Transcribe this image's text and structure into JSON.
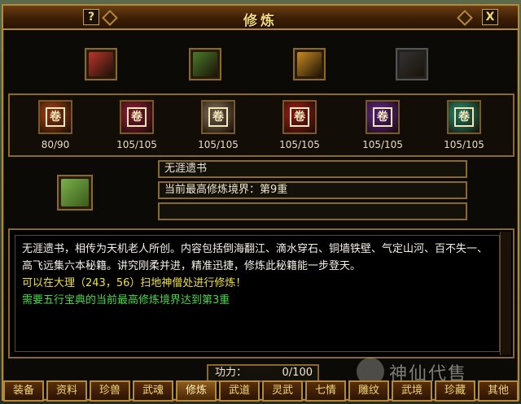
{
  "window": {
    "title": "修炼",
    "help_label": "?",
    "close_label": "X"
  },
  "top_items": [
    {
      "icon": "red-book-icon",
      "color": "#b8352a"
    },
    {
      "icon": "bamboo-scroll-icon",
      "color": "#4a7a2a"
    },
    {
      "icon": "golden-treasure-icon",
      "color": "#c88a20"
    },
    {
      "icon": "empty-slot-icon",
      "color": "#333333"
    }
  ],
  "skills": [
    {
      "value": "80/90",
      "color": "#b34a1a",
      "glyph": "卷"
    },
    {
      "value": "105/105",
      "color": "#a02040",
      "glyph": "卷"
    },
    {
      "value": "105/105",
      "color": "#8a7a60",
      "glyph": "卷"
    },
    {
      "value": "105/105",
      "color": "#b02020",
      "glyph": "卷"
    },
    {
      "value": "105/105",
      "color": "#6a2aa0",
      "glyph": "卷"
    },
    {
      "value": "105/105",
      "color": "#2a9a7a",
      "glyph": "卷"
    }
  ],
  "selected": {
    "name": "无涯遗书",
    "realm": "当前最高修炼境界：第9重",
    "extra": ""
  },
  "description": {
    "text": "无涯遗书，相传为天机老人所创。内容包括倒海翻江、滴水穿石、铜墙铁壁、气定山河、百不失一、高飞远集六本秘籍。讲究刚柔并进，精准迅捷，修炼此秘籍能一步登天。",
    "location": "可以在大理（243，56）扫地神僧处进行修炼！",
    "requirement": "需要五行宝典的当前最高修炼境界达到第3重"
  },
  "power": {
    "label": "功力：",
    "value": "0/100"
  },
  "tabs": [
    "装备",
    "资料",
    "珍兽",
    "武魂",
    "修炼",
    "武道",
    "灵武",
    "七情",
    "雕纹",
    "武境",
    "珍藏",
    "其他"
  ],
  "active_tab": "修炼",
  "watermark": "神仙代售"
}
